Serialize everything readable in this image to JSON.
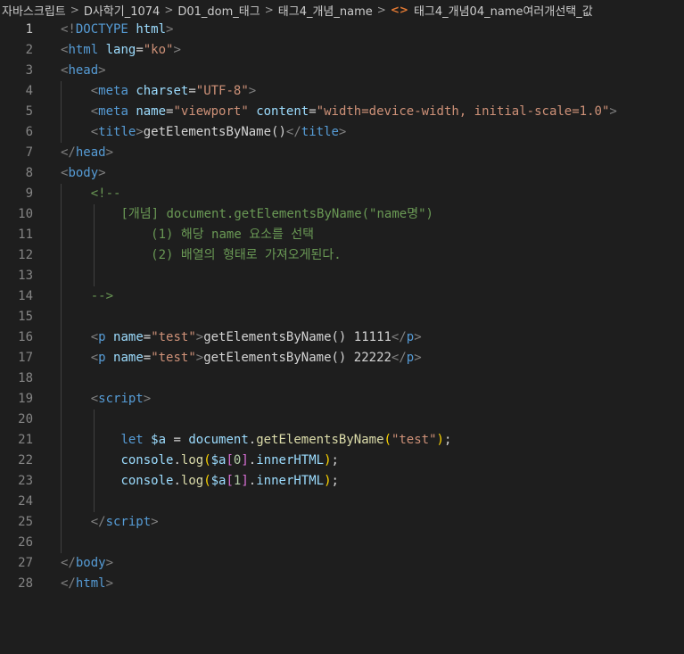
{
  "breadcrumb": {
    "items": [
      "자바스크립트",
      "D사학기_1074",
      "D01_dom_태그",
      "태그4_개념_name",
      "태그4_개념04_name여러개선택_값"
    ],
    "file_icon": "<>"
  },
  "editor": {
    "active_line": 1,
    "lines": [
      {
        "n": "1",
        "tokens": [
          [
            "t-punc",
            "<!"
          ],
          [
            "t-doctype",
            "DOCTYPE"
          ],
          [
            "t-text",
            " "
          ],
          [
            "t-doctype-kw",
            "html"
          ],
          [
            "t-punc",
            ">"
          ]
        ]
      },
      {
        "n": "2",
        "tokens": [
          [
            "t-punc",
            "<"
          ],
          [
            "t-tag",
            "html"
          ],
          [
            "t-text",
            " "
          ],
          [
            "t-attr",
            "lang"
          ],
          [
            "t-text",
            "="
          ],
          [
            "t-str",
            "\"ko\""
          ],
          [
            "t-punc",
            ">"
          ]
        ]
      },
      {
        "n": "3",
        "tokens": [
          [
            "t-punc",
            "<"
          ],
          [
            "t-tag",
            "head"
          ],
          [
            "t-punc",
            ">"
          ]
        ]
      },
      {
        "n": "4",
        "tokens": [
          [
            "t-text",
            "    "
          ],
          [
            "t-punc",
            "<"
          ],
          [
            "t-tag",
            "meta"
          ],
          [
            "t-text",
            " "
          ],
          [
            "t-attr",
            "charset"
          ],
          [
            "t-text",
            "="
          ],
          [
            "t-str",
            "\"UTF-8\""
          ],
          [
            "t-punc",
            ">"
          ]
        ]
      },
      {
        "n": "5",
        "tokens": [
          [
            "t-text",
            "    "
          ],
          [
            "t-punc",
            "<"
          ],
          [
            "t-tag",
            "meta"
          ],
          [
            "t-text",
            " "
          ],
          [
            "t-attr",
            "name"
          ],
          [
            "t-text",
            "="
          ],
          [
            "t-str",
            "\"viewport\""
          ],
          [
            "t-text",
            " "
          ],
          [
            "t-attr",
            "content"
          ],
          [
            "t-text",
            "="
          ],
          [
            "t-str",
            "\"width=device-width, initial-scale=1.0\""
          ],
          [
            "t-punc",
            ">"
          ]
        ]
      },
      {
        "n": "6",
        "tokens": [
          [
            "t-text",
            "    "
          ],
          [
            "t-punc",
            "<"
          ],
          [
            "t-tag",
            "title"
          ],
          [
            "t-punc",
            ">"
          ],
          [
            "t-text",
            "getElementsByName()"
          ],
          [
            "t-punc",
            "</"
          ],
          [
            "t-tag",
            "title"
          ],
          [
            "t-punc",
            ">"
          ]
        ]
      },
      {
        "n": "7",
        "tokens": [
          [
            "t-punc",
            "</"
          ],
          [
            "t-tag",
            "head"
          ],
          [
            "t-punc",
            ">"
          ]
        ]
      },
      {
        "n": "8",
        "tokens": [
          [
            "t-punc",
            "<"
          ],
          [
            "t-tag",
            "body"
          ],
          [
            "t-punc",
            ">"
          ]
        ]
      },
      {
        "n": "9",
        "tokens": [
          [
            "t-text",
            "    "
          ],
          [
            "t-comment",
            "<!--"
          ]
        ]
      },
      {
        "n": "10",
        "tokens": [
          [
            "t-text",
            "        "
          ],
          [
            "t-comment",
            "[개념] document.getElementsByName(\"name명\")"
          ]
        ]
      },
      {
        "n": "11",
        "tokens": [
          [
            "t-text",
            "            "
          ],
          [
            "t-comment",
            "(1) 해당 name 요소를 선택"
          ]
        ]
      },
      {
        "n": "12",
        "tokens": [
          [
            "t-text",
            "            "
          ],
          [
            "t-comment",
            "(2) 배열의 형태로 가져오게된다."
          ]
        ]
      },
      {
        "n": "13",
        "tokens": []
      },
      {
        "n": "14",
        "tokens": [
          [
            "t-text",
            "    "
          ],
          [
            "t-comment",
            "-->"
          ]
        ]
      },
      {
        "n": "15",
        "tokens": []
      },
      {
        "n": "16",
        "tokens": [
          [
            "t-text",
            "    "
          ],
          [
            "t-punc",
            "<"
          ],
          [
            "t-tag",
            "p"
          ],
          [
            "t-text",
            " "
          ],
          [
            "t-attr",
            "name"
          ],
          [
            "t-text",
            "="
          ],
          [
            "t-str",
            "\"test\""
          ],
          [
            "t-punc",
            ">"
          ],
          [
            "t-text",
            "getElementsByName() 11111"
          ],
          [
            "t-punc",
            "</"
          ],
          [
            "t-tag",
            "p"
          ],
          [
            "t-punc",
            ">"
          ]
        ]
      },
      {
        "n": "17",
        "tokens": [
          [
            "t-text",
            "    "
          ],
          [
            "t-punc",
            "<"
          ],
          [
            "t-tag",
            "p"
          ],
          [
            "t-text",
            " "
          ],
          [
            "t-attr",
            "name"
          ],
          [
            "t-text",
            "="
          ],
          [
            "t-str",
            "\"test\""
          ],
          [
            "t-punc",
            ">"
          ],
          [
            "t-text",
            "getElementsByName() 22222"
          ],
          [
            "t-punc",
            "</"
          ],
          [
            "t-tag",
            "p"
          ],
          [
            "t-punc",
            ">"
          ]
        ]
      },
      {
        "n": "18",
        "tokens": []
      },
      {
        "n": "19",
        "tokens": [
          [
            "t-text",
            "    "
          ],
          [
            "t-punc",
            "<"
          ],
          [
            "t-tag",
            "script"
          ],
          [
            "t-punc",
            ">"
          ]
        ]
      },
      {
        "n": "20",
        "tokens": []
      },
      {
        "n": "21",
        "tokens": [
          [
            "t-text",
            "        "
          ],
          [
            "t-kw",
            "let"
          ],
          [
            "t-text",
            " "
          ],
          [
            "t-var",
            "$a"
          ],
          [
            "t-text",
            " = "
          ],
          [
            "t-var",
            "document"
          ],
          [
            "t-text",
            "."
          ],
          [
            "t-fn",
            "getElementsByName"
          ],
          [
            "t-brace2",
            "("
          ],
          [
            "t-str",
            "\"test\""
          ],
          [
            "t-brace2",
            ")"
          ],
          [
            "t-text",
            ";"
          ]
        ]
      },
      {
        "n": "22",
        "tokens": [
          [
            "t-text",
            "        "
          ],
          [
            "t-var",
            "console"
          ],
          [
            "t-text",
            "."
          ],
          [
            "t-fn",
            "log"
          ],
          [
            "t-brace2",
            "("
          ],
          [
            "t-var",
            "$a"
          ],
          [
            "t-brace",
            "["
          ],
          [
            "t-num",
            "0"
          ],
          [
            "t-brace",
            "]"
          ],
          [
            "t-text",
            "."
          ],
          [
            "t-var",
            "innerHTML"
          ],
          [
            "t-brace2",
            ")"
          ],
          [
            "t-text",
            ";"
          ]
        ]
      },
      {
        "n": "23",
        "tokens": [
          [
            "t-text",
            "        "
          ],
          [
            "t-var",
            "console"
          ],
          [
            "t-text",
            "."
          ],
          [
            "t-fn",
            "log"
          ],
          [
            "t-brace2",
            "("
          ],
          [
            "t-var",
            "$a"
          ],
          [
            "t-brace",
            "["
          ],
          [
            "t-num",
            "1"
          ],
          [
            "t-brace",
            "]"
          ],
          [
            "t-text",
            "."
          ],
          [
            "t-var",
            "innerHTML"
          ],
          [
            "t-brace2",
            ")"
          ],
          [
            "t-text",
            ";"
          ]
        ]
      },
      {
        "n": "24",
        "tokens": []
      },
      {
        "n": "25",
        "tokens": [
          [
            "t-text",
            "    "
          ],
          [
            "t-punc",
            "</"
          ],
          [
            "t-tag",
            "script"
          ],
          [
            "t-punc",
            ">"
          ]
        ]
      },
      {
        "n": "26",
        "tokens": []
      },
      {
        "n": "27",
        "tokens": [
          [
            "t-punc",
            "</"
          ],
          [
            "t-tag",
            "body"
          ],
          [
            "t-punc",
            ">"
          ]
        ]
      },
      {
        "n": "28",
        "tokens": [
          [
            "t-punc",
            "</"
          ],
          [
            "t-tag",
            "html"
          ],
          [
            "t-punc",
            ">"
          ]
        ]
      }
    ]
  }
}
